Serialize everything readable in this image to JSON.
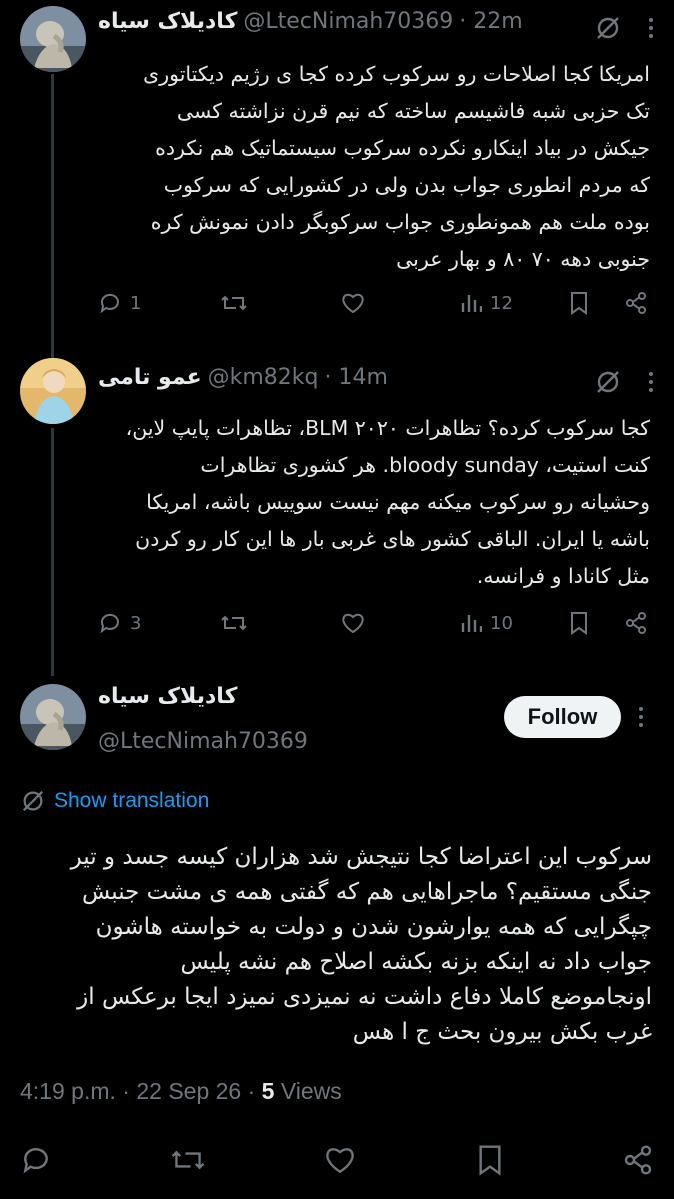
{
  "tweets": [
    {
      "name": "کادیلاک سیاه",
      "handle": "@LtecNimah70369",
      "time": "· 22m",
      "lines": [
        "امریکا کجا اصلاحات رو سرکوب کرده کجا ی رژیم دیکتاتوری",
        "تک حزبی شبه فاشیسم ساخته که نیم قرن نزاشته کسی",
        "جیکش در بیاد اینکارو نکرده سرکوب سیستماتیک هم نکرده",
        "که مردم انطوری جواب بدن ولی در کشورایی که سرکوب",
        "بوده ملت هم همونطوری جواب سرکوبگر دادن نمونش کره",
        "جنوبی دهه ۷۰ ۸۰ و بهار عربی"
      ],
      "replies": "1",
      "retweets": "",
      "likes": "",
      "views": "12"
    },
    {
      "name": "عمو تامی",
      "handle": "@km82kq",
      "time": "· 14m",
      "lines": [
        "کجا سرکوب کرده؟ تظاهرات ۲۰۲۰ BLM، تظاهرات پایپ لاین،",
        "کنت استیت، bloody sunday. هر کشوری تظاهرات",
        "وحشیانه رو سرکوب میکنه مهم نیست سوییس باشه، امریکا",
        "باشه یا ایران. الباقی کشور های غربی بار ها این کار رو کردن",
        "مثل کانادا و فرانسه."
      ],
      "replies": "3",
      "retweets": "",
      "likes": "",
      "views": "10"
    }
  ],
  "main_tweet": {
    "name": "کادیلاک سیاه",
    "handle": "@LtecNimah70369",
    "follow_label": "Follow",
    "translate_label": "Show translation",
    "lines": [
      "سرکوب این اعتراضا کجا نتیجش شد هزاران کیسه جسد و تیر",
      "جنگی مستقیم؟ ماجراهایی هم که گفتی همه ی مشت جنبش",
      "چپگرایی که همه یوارشون شدن و دولت به خواسته هاشون",
      "جواب داد نه اینکه بزنه بکشه اصلاح هم نشه پلیس",
      "اونجاموضع کاملا دفاع داشت نه نمیزدی نمیزد ایجا برعکس از",
      "غرب بکش بیرون بحث ج ا هس"
    ],
    "time": "4:19 p.m.",
    "date": "22 Sep 26",
    "views_count": "5",
    "views_label": "Views"
  },
  "icons": [
    "grok-slash-icon",
    "more-icon",
    "reply-icon",
    "retweet-icon",
    "like-icon",
    "views-icon",
    "bookmark-icon",
    "share-icon",
    "translate-icon"
  ],
  "colors": {
    "background": "#000000",
    "text": "#e7e9ea",
    "muted": "#71767b",
    "link": "#1d9bf0",
    "follow_bg": "#eff3f4"
  }
}
